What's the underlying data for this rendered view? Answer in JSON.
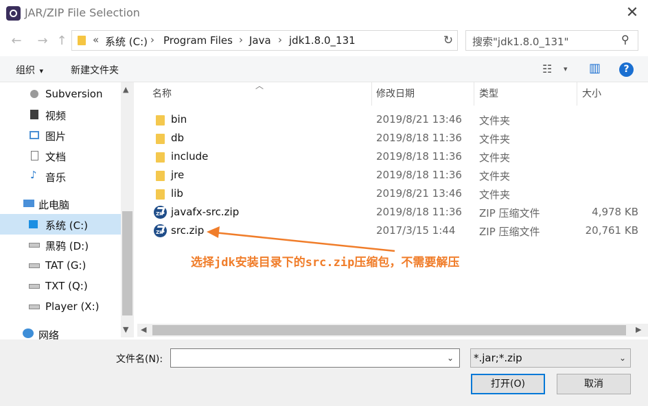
{
  "window": {
    "title": "JAR/ZIP File Selection",
    "close_glyph": "✕",
    "icon": "app-gear-icon"
  },
  "nav": {
    "back_glyph": "←",
    "forward_glyph": "→",
    "up_glyph": "↑",
    "overflow": "«",
    "breadcrumbs": [
      "系统 (C:)",
      "Program Files",
      "Java",
      "jdk1.8.0_131"
    ],
    "separator": "›",
    "dropdown_glyph": "⌄",
    "refresh_glyph": "↻",
    "search_placeholder": "搜索\"jdk1.8.0_131\"",
    "search_glyph": "⚲"
  },
  "toolbar": {
    "organize_label": "组织",
    "organize_caret": "▾",
    "new_folder_label": "新建文件夹",
    "view_glyph": "☷",
    "view_caret": "▾",
    "pane_glyph": "▥",
    "help_glyph": "?"
  },
  "sidebar": {
    "items": [
      {
        "label": "Subversion",
        "icon": "subversion-icon"
      },
      {
        "label": "视频",
        "icon": "video-icon"
      },
      {
        "label": "图片",
        "icon": "pictures-icon"
      },
      {
        "label": "文档",
        "icon": "documents-icon"
      },
      {
        "label": "音乐",
        "icon": "music-icon"
      },
      {
        "label": "此电脑",
        "icon": "computer-icon"
      },
      {
        "label": "系统 (C:)",
        "icon": "windows-drive-icon",
        "selected": true
      },
      {
        "label": "黑鸦 (D:)",
        "icon": "drive-icon"
      },
      {
        "label": "TAT (G:)",
        "icon": "drive-icon"
      },
      {
        "label": "TXT (Q:)",
        "icon": "drive-icon"
      },
      {
        "label": "Player (X:)",
        "icon": "drive-icon"
      },
      {
        "label": "网络",
        "icon": "network-icon"
      }
    ],
    "scroll_up": "▲",
    "scroll_down": "▼"
  },
  "filelist": {
    "sort_caret": "︿",
    "columns": [
      "名称",
      "修改日期",
      "类型",
      "大小"
    ],
    "rows": [
      {
        "name": "bin",
        "date": "2019/8/21 13:46",
        "type": "文件夹",
        "size": "",
        "kind": "folder"
      },
      {
        "name": "db",
        "date": "2019/8/18 11:36",
        "type": "文件夹",
        "size": "",
        "kind": "folder"
      },
      {
        "name": "include",
        "date": "2019/8/18 11:36",
        "type": "文件夹",
        "size": "",
        "kind": "folder"
      },
      {
        "name": "jre",
        "date": "2019/8/18 11:36",
        "type": "文件夹",
        "size": "",
        "kind": "folder"
      },
      {
        "name": "lib",
        "date": "2019/8/21 13:46",
        "type": "文件夹",
        "size": "",
        "kind": "folder"
      },
      {
        "name": "javafx-src.zip",
        "date": "2019/8/18 11:36",
        "type": "ZIP 压缩文件",
        "size": "4,978 KB",
        "kind": "zip"
      },
      {
        "name": "src.zip",
        "date": "2017/3/15 1:44",
        "type": "ZIP 压缩文件",
        "size": "20,761 KB",
        "kind": "zip"
      }
    ],
    "zip_badge": "ZIP",
    "hscroll_left": "◀",
    "hscroll_right": "▶"
  },
  "annotation": {
    "text": "选择jdk安装目录下的src.zip压缩包，不需要解压",
    "color": "#f07d2a"
  },
  "bottom": {
    "filename_label": "文件名(N):",
    "filename_value": "",
    "filename_dropdown": "⌄",
    "filter_value": "*.jar;*.zip",
    "filter_dropdown": "⌄",
    "open_label": "打开(O)",
    "cancel_label": "取消"
  },
  "colors": {
    "accent": "#0078d7",
    "selection": "#cce4f7",
    "folder": "#f4c84e"
  }
}
